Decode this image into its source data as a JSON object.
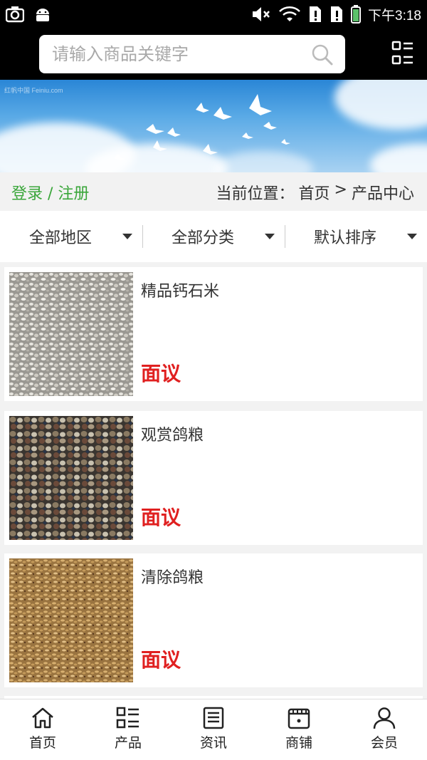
{
  "status_bar": {
    "time": "下午3:18"
  },
  "search": {
    "placeholder": "请输入商品关键字"
  },
  "banner": {
    "caption": "红帆中国 Feiniu.com"
  },
  "breadcrumb": {
    "login_label": "登录 / 注册",
    "prefix": "当前位置：",
    "home": "首页",
    "separator": ">",
    "current": "产品中心"
  },
  "filters": [
    {
      "label": "全部地区"
    },
    {
      "label": "全部分类"
    },
    {
      "label": "默认排序"
    }
  ],
  "products": [
    {
      "name": "精品钙石米",
      "price": "面议",
      "image": "white-grit"
    },
    {
      "name": "观赏鸽粮",
      "price": "面议",
      "image": "mixed-seeds"
    },
    {
      "name": "清除鸽粮",
      "price": "面议",
      "image": "brown-grains"
    }
  ],
  "tabs": [
    {
      "label": "首页",
      "icon": "home-icon"
    },
    {
      "label": "产品",
      "icon": "grid-list-icon"
    },
    {
      "label": "资讯",
      "icon": "news-icon"
    },
    {
      "label": "商铺",
      "icon": "store-icon"
    },
    {
      "label": "会员",
      "icon": "user-icon"
    }
  ]
}
